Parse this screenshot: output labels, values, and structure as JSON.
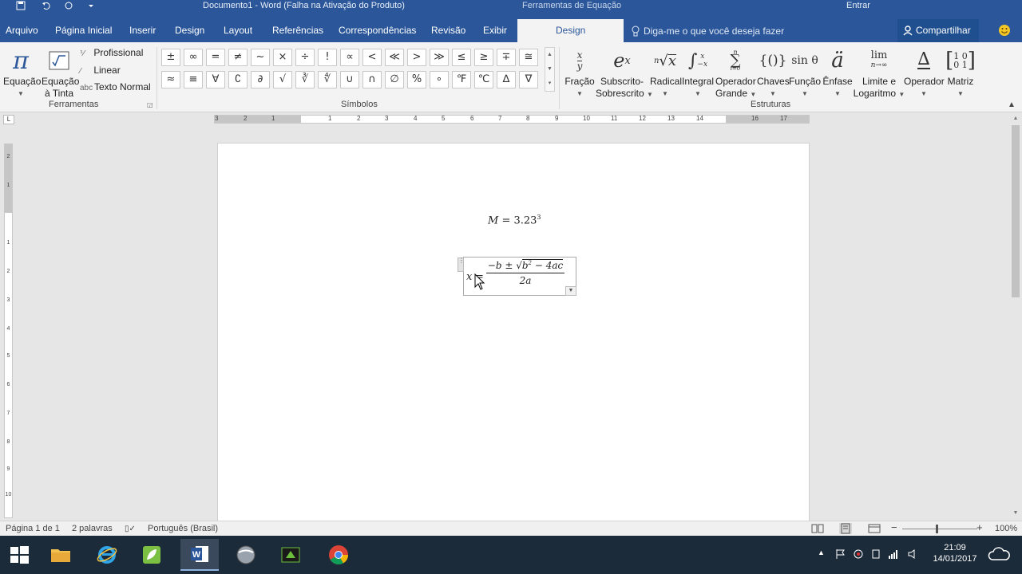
{
  "titlebar": {
    "document_title": "Documento1 - Word (Falha na Ativação do Produto)",
    "context_label": "Ferramentas de Equação",
    "signin": "Entrar"
  },
  "tabs": [
    {
      "label": "Arquivo"
    },
    {
      "label": "Página Inicial"
    },
    {
      "label": "Inserir"
    },
    {
      "label": "Design"
    },
    {
      "label": "Layout"
    },
    {
      "label": "Referências"
    },
    {
      "label": "Correspondências"
    },
    {
      "label": "Revisão"
    },
    {
      "label": "Exibir"
    },
    {
      "label": "Design"
    }
  ],
  "tellme": "Diga-me o que você deseja fazer",
  "share": "Compartilhar",
  "ribbon": {
    "tools": {
      "label": "Ferramentas",
      "equation": "Equação",
      "ink_line1": "Equação",
      "ink_line2": "à Tinta",
      "professional": "Profissional",
      "linear": "Linear",
      "normal_text": "Texto Normal",
      "normal_text_icon": "abc"
    },
    "symbols": {
      "label": "Símbolos",
      "row1": [
        "±",
        "∞",
        "=",
        "≠",
        "~",
        "×",
        "÷",
        "!",
        "∝",
        "<",
        "≪",
        ">",
        "≫",
        "≤",
        "≥",
        "∓",
        "≅"
      ],
      "row2": [
        "≈",
        "≡",
        "∀",
        "∁",
        "∂",
        "√",
        "∛",
        "∜",
        "∪",
        "∩",
        "∅",
        "%",
        "∘",
        "℉",
        "℃",
        "∆",
        "∇"
      ]
    },
    "structures": {
      "label": "Estruturas",
      "fraction": "Fração",
      "script_line1": "Subscrito-",
      "script_line2": "Sobrescrito",
      "radical": "Radical",
      "integral": "Integral",
      "large_op_line1": "Operador",
      "large_op_line2": "Grande",
      "bracket": "Chaves",
      "function": "Função",
      "accent": "Ênfase",
      "limit_line1": "Limite e",
      "limit_line2": "Logaritmo",
      "operator": "Operador",
      "matrix": "Matriz",
      "function_icon": "sin θ",
      "limit_icon_top": "lim",
      "limit_icon_bottom": "n→∞"
    }
  },
  "ruler": {
    "numbers": [
      "3",
      "2",
      "1",
      "1",
      "2",
      "3",
      "4",
      "5",
      "6",
      "7",
      "8",
      "9",
      "10",
      "11",
      "12",
      "13",
      "14",
      "16",
      "17"
    ],
    "vnumbers": [
      "2",
      "1",
      "1",
      "2",
      "3",
      "4",
      "5",
      "6",
      "7",
      "8",
      "9",
      "10"
    ]
  },
  "document": {
    "eq1": {
      "var": "M",
      "rest": " = 3.23",
      "exp": "3"
    },
    "eq2": {
      "lhs": "x",
      "eq": "=",
      "num_prefix": "−b ± ",
      "rad_sign": "√",
      "b": "b",
      "b_exp": "2",
      "rest": " − 4ac",
      "den": "2a"
    }
  },
  "status": {
    "page": "Página 1 de 1",
    "words": "2 palavras",
    "language": "Português (Brasil)",
    "zoom": "100%"
  },
  "clock": {
    "time": "21:09",
    "date": "14/01/2017"
  },
  "colors": {
    "accent": "#2b579a"
  }
}
